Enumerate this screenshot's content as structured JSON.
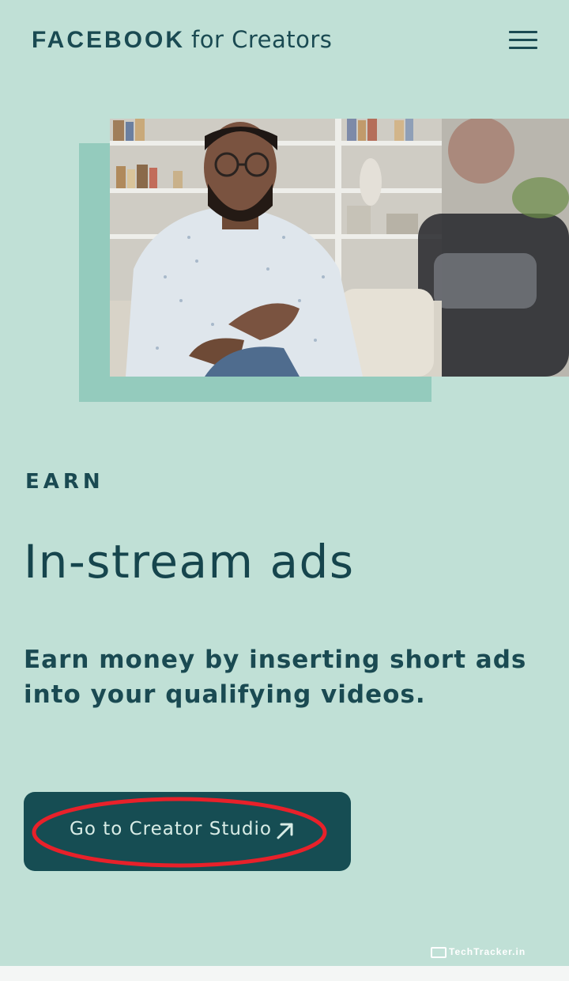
{
  "header": {
    "brand": "FACEBOOK",
    "brand_suffix": "for Creators",
    "menu_icon": "hamburger-menu-icon"
  },
  "hero": {
    "image": "creator-recording-video-photo"
  },
  "section": {
    "eyebrow": "EARN",
    "title": "In-stream ads",
    "description": "Earn money by inserting short ads into your qualifying videos."
  },
  "cta": {
    "label": "Go to Creator Studio",
    "icon": "arrow-up-right-icon"
  },
  "watermark": {
    "text": "TechTracker.in"
  },
  "colors": {
    "background": "#c0e0d6",
    "accent_block": "#94cbbd",
    "button": "#164d53",
    "text": "#17464d",
    "annotation": "#e8212a"
  }
}
